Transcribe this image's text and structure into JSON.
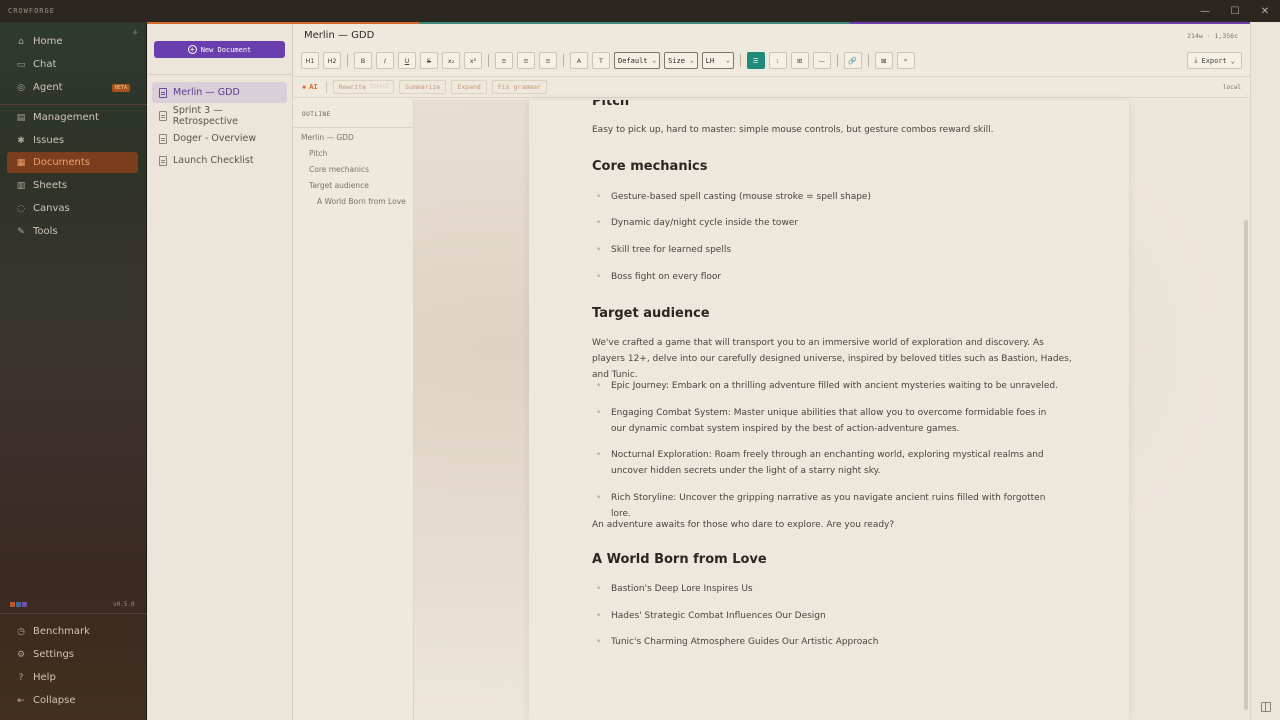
{
  "app": {
    "name": "CROWFORGE",
    "controls": [
      "—",
      "☐",
      "✕"
    ]
  },
  "nav": {
    "items": [
      {
        "label": "Home",
        "icon": "home-icon",
        "glyph": "⌂"
      },
      {
        "label": "Chat",
        "icon": "chat-icon",
        "glyph": "▭"
      },
      {
        "label": "Agent",
        "icon": "agent-icon",
        "glyph": "◎",
        "badge": "BETA"
      },
      {
        "label": "Management",
        "icon": "management-icon",
        "glyph": "▤"
      },
      {
        "label": "Issues",
        "icon": "issues-icon",
        "glyph": "✱"
      },
      {
        "label": "Documents",
        "icon": "documents-icon",
        "glyph": "▦",
        "active": true
      },
      {
        "label": "Sheets",
        "icon": "sheets-icon",
        "glyph": "▥"
      },
      {
        "label": "Canvas",
        "icon": "canvas-icon",
        "glyph": "◌"
      },
      {
        "label": "Tools",
        "icon": "tools-icon",
        "glyph": "✎"
      }
    ],
    "bottom": [
      {
        "label": "Benchmark",
        "icon": "benchmark-icon",
        "glyph": "◷"
      },
      {
        "label": "Settings",
        "icon": "settings-icon",
        "glyph": "⚙"
      },
      {
        "label": "Help",
        "icon": "help-icon",
        "glyph": "?"
      },
      {
        "label": "Collapse",
        "icon": "collapse-icon",
        "glyph": "⇤"
      }
    ],
    "version": "v0.5.0",
    "swatches": [
      "#c0562a",
      "#3c6b9a",
      "#7b4aa8"
    ]
  },
  "docs": {
    "new_label": "New Document",
    "items": [
      {
        "label": "Merlin — GDD",
        "active": true
      },
      {
        "label": "Sprint 3 — Retrospective"
      },
      {
        "label": "Doger - Overview"
      },
      {
        "label": "Launch Checklist"
      }
    ]
  },
  "editor": {
    "title": "Merlin — GDD",
    "stats": "214w · 1,356c",
    "toolbar": {
      "groups": [
        [
          "H1",
          "H2"
        ],
        [
          "B",
          "I",
          "U",
          "S",
          "x₂",
          "x²"
        ],
        [
          "≡",
          "≡",
          "≡"
        ],
        [
          "A",
          "T"
        ]
      ],
      "font_select": "Default",
      "size_select": "Size",
      "lh_select": "LH",
      "list_buttons": [
        "☰",
        "⁝",
        "⊞",
        "—"
      ],
      "extra_buttons": [
        "🔗",
        "⊠",
        "⌕"
      ],
      "export_label": "Export"
    },
    "ai": {
      "label": "AI",
      "actions": [
        {
          "label": "Rewrite",
          "kbd": "Ctrl+J"
        },
        {
          "label": "Summarize"
        },
        {
          "label": "Expand"
        },
        {
          "label": "Fix grammar"
        }
      ],
      "mode": "local"
    }
  },
  "outline": {
    "heading": "OUTLINE",
    "items": [
      {
        "label": "Merlin — GDD",
        "level": 1
      },
      {
        "label": "Pitch",
        "level": 2
      },
      {
        "label": "Core mechanics",
        "level": 2
      },
      {
        "label": "Target audience",
        "level": 2
      },
      {
        "label": "A World Born from Love",
        "level": 3
      }
    ]
  },
  "document": {
    "pitch_heading": "Pitch",
    "pitch_text": "Easy to pick up, hard to master: simple mouse controls, but gesture combos reward skill.",
    "core_heading": "Core mechanics",
    "core_items": [
      "Gesture-based spell casting (mouse stroke = spell shape)",
      "Dynamic day/night cycle inside the tower",
      "Skill tree for learned spells",
      "Boss fight on every floor"
    ],
    "audience_heading": "Target audience",
    "audience_text": "We've crafted a game that will transport you to an immersive world of exploration and discovery. As players 12+, delve into our carefully designed universe, inspired by beloved titles such as Bastion, Hades, and Tunic.",
    "audience_items": [
      "Epic Journey: Embark on a thrilling adventure filled with ancient mysteries waiting to be unraveled.",
      "Engaging Combat System: Master unique abilities that allow you to overcome formidable foes in our dynamic combat system inspired by the best of action-adventure games.",
      "Nocturnal Exploration: Roam freely through an enchanting world, exploring mystical realms and uncover hidden secrets under the light of a starry night sky.",
      "Rich Storyline: Uncover the gripping narrative as you navigate ancient ruins filled with forgotten lore."
    ],
    "audience_closing": "An adventure awaits for those who dare to explore. Are you ready?",
    "world_heading": "A World Born from Love",
    "world_items": [
      "Bastion's Deep Lore Inspires Us",
      "Hades' Strategic Combat Influences Our Design",
      "Tunic's Charming Atmosphere Guides Our Artistic Approach"
    ]
  }
}
